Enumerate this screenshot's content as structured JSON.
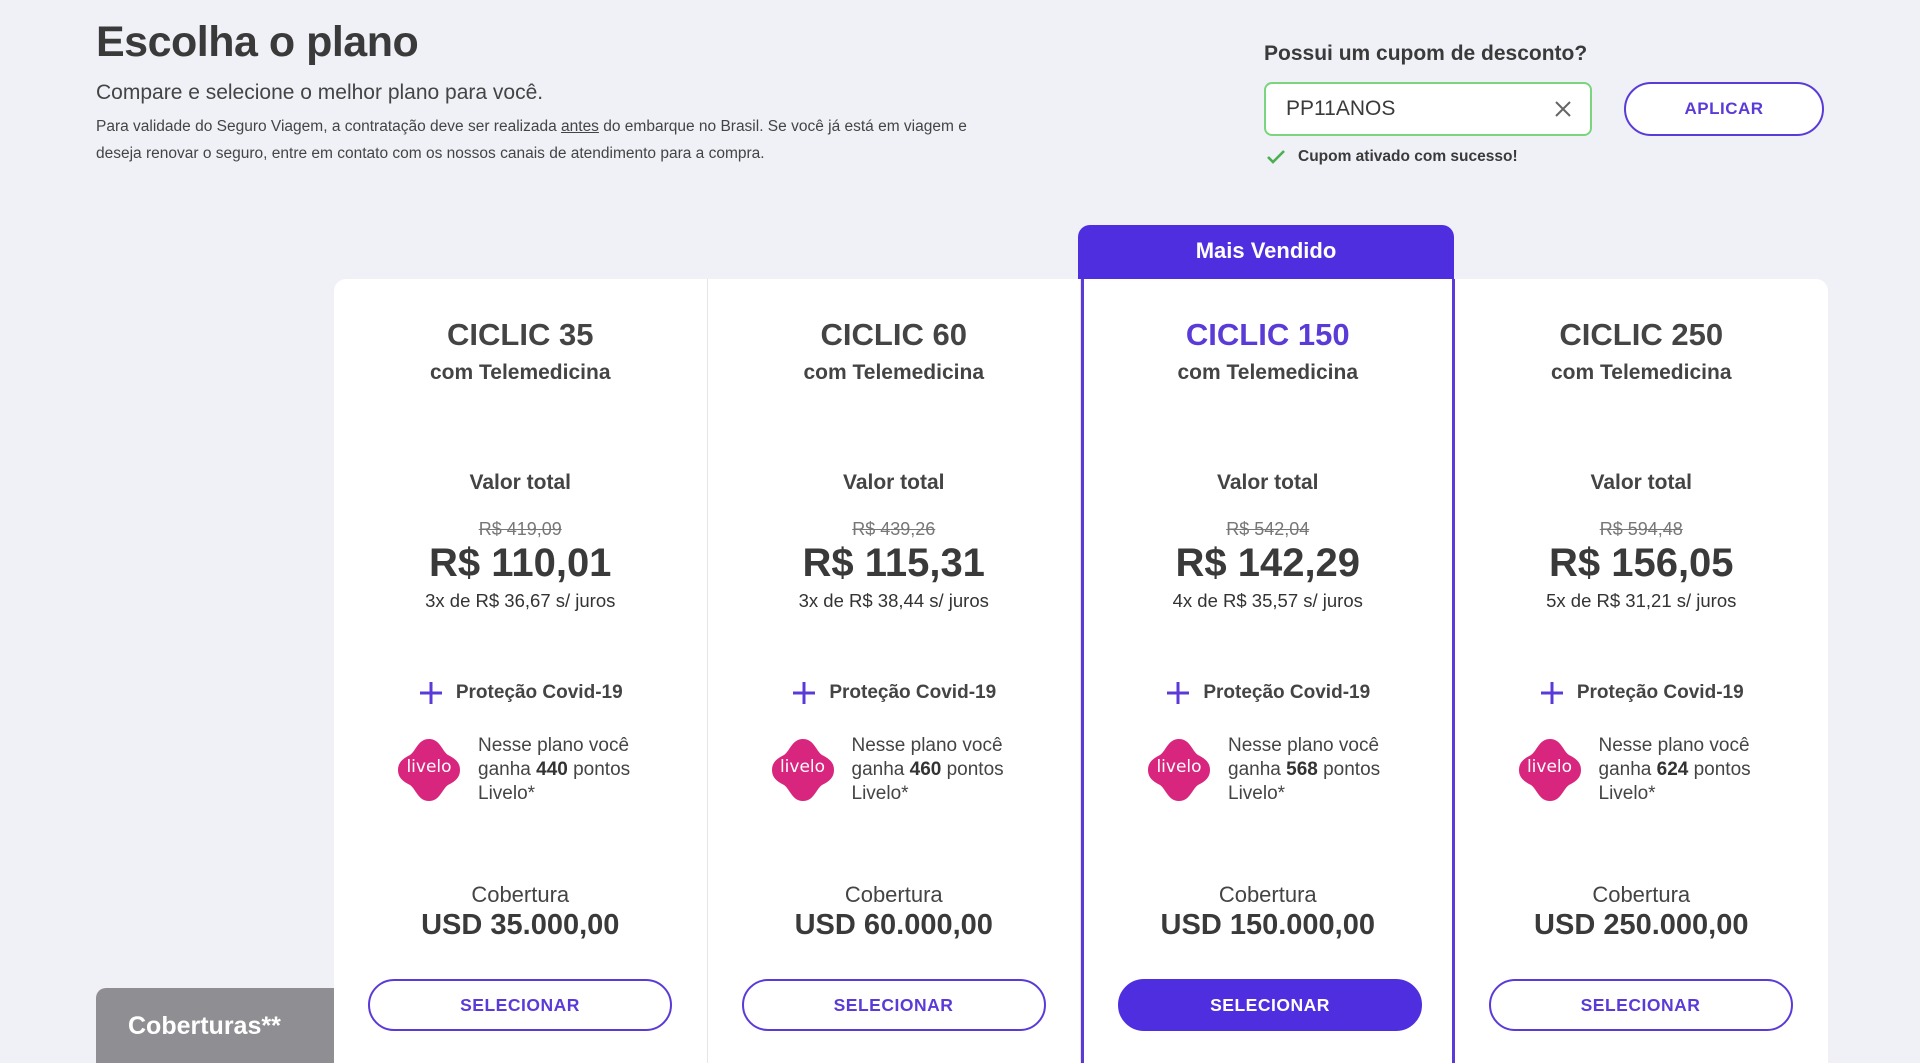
{
  "header": {
    "title": "Escolha o plano",
    "subtitle": "Compare e selecione o melhor plano para você.",
    "note_before": "Para validade do Seguro Viagem, a contratação deve ser realizada ",
    "note_underlined": "antes",
    "note_after": " do embarque no Brasil. Se você já está em viagem e deseja renovar o seguro, entre em contato com os nossos canais de atendimento para a compra."
  },
  "coupon": {
    "title": "Possui um cupom de desconto?",
    "value": "PP11ANOS",
    "apply_label": "APLICAR",
    "status": "Cupom ativado com sucesso!"
  },
  "best_seller_label": "Mais Vendido",
  "plans": [
    {
      "name": "CICLIC 35",
      "subtitle": "com Telemedicina",
      "total_label": "Valor total",
      "old_price": "R$ 419,09",
      "price": "R$ 110,01",
      "installments": "3x de R$ 36,67 s/ juros",
      "covid_label": "Proteção Covid-19",
      "livelo_prefix": "Nesse plano você ganha ",
      "livelo_points": "440",
      "livelo_suffix": " pontos Livelo*",
      "coverage_label": "Cobertura",
      "coverage_value": "USD 35.000,00",
      "select_label": "SELECIONAR"
    },
    {
      "name": "CICLIC 60",
      "subtitle": "com Telemedicina",
      "total_label": "Valor total",
      "old_price": "R$ 439,26",
      "price": "R$ 115,31",
      "installments": "3x de R$ 38,44 s/ juros",
      "covid_label": "Proteção Covid-19",
      "livelo_prefix": "Nesse plano você ganha ",
      "livelo_points": "460",
      "livelo_suffix": " pontos Livelo*",
      "coverage_label": "Cobertura",
      "coverage_value": "USD 60.000,00",
      "select_label": "SELECIONAR"
    },
    {
      "name": "CICLIC 150",
      "subtitle": "com Telemedicina",
      "total_label": "Valor total",
      "old_price": "R$ 542,04",
      "price": "R$ 142,29",
      "installments": "4x de R$ 35,57 s/ juros",
      "covid_label": "Proteção Covid-19",
      "livelo_prefix": "Nesse plano você ganha ",
      "livelo_points": "568",
      "livelo_suffix": " pontos Livelo*",
      "coverage_label": "Cobertura",
      "coverage_value": "USD 150.000,00",
      "select_label": "SELECIONAR"
    },
    {
      "name": "CICLIC 250",
      "subtitle": "com Telemedicina",
      "total_label": "Valor total",
      "old_price": "R$ 594,48",
      "price": "R$ 156,05",
      "installments": "5x de R$ 31,21 s/ juros",
      "covid_label": "Proteção Covid-19",
      "livelo_prefix": "Nesse plano você ganha ",
      "livelo_points": "624",
      "livelo_suffix": " pontos Livelo*",
      "coverage_label": "Cobertura",
      "coverage_value": "USD 250.000,00",
      "select_label": "SELECIONAR"
    }
  ],
  "livelo_logo_text": "livelo",
  "coverages_tab_label": "Coberturas**",
  "colors": {
    "accent": "#5b3bd8",
    "accent_fill": "#4f2ee0",
    "livelo_pink": "#d8267f",
    "success": "#4caf50",
    "coupon_border": "#7bd47e"
  },
  "icons": [
    "close-icon",
    "check-icon",
    "plus-icon",
    "livelo-logo"
  ]
}
